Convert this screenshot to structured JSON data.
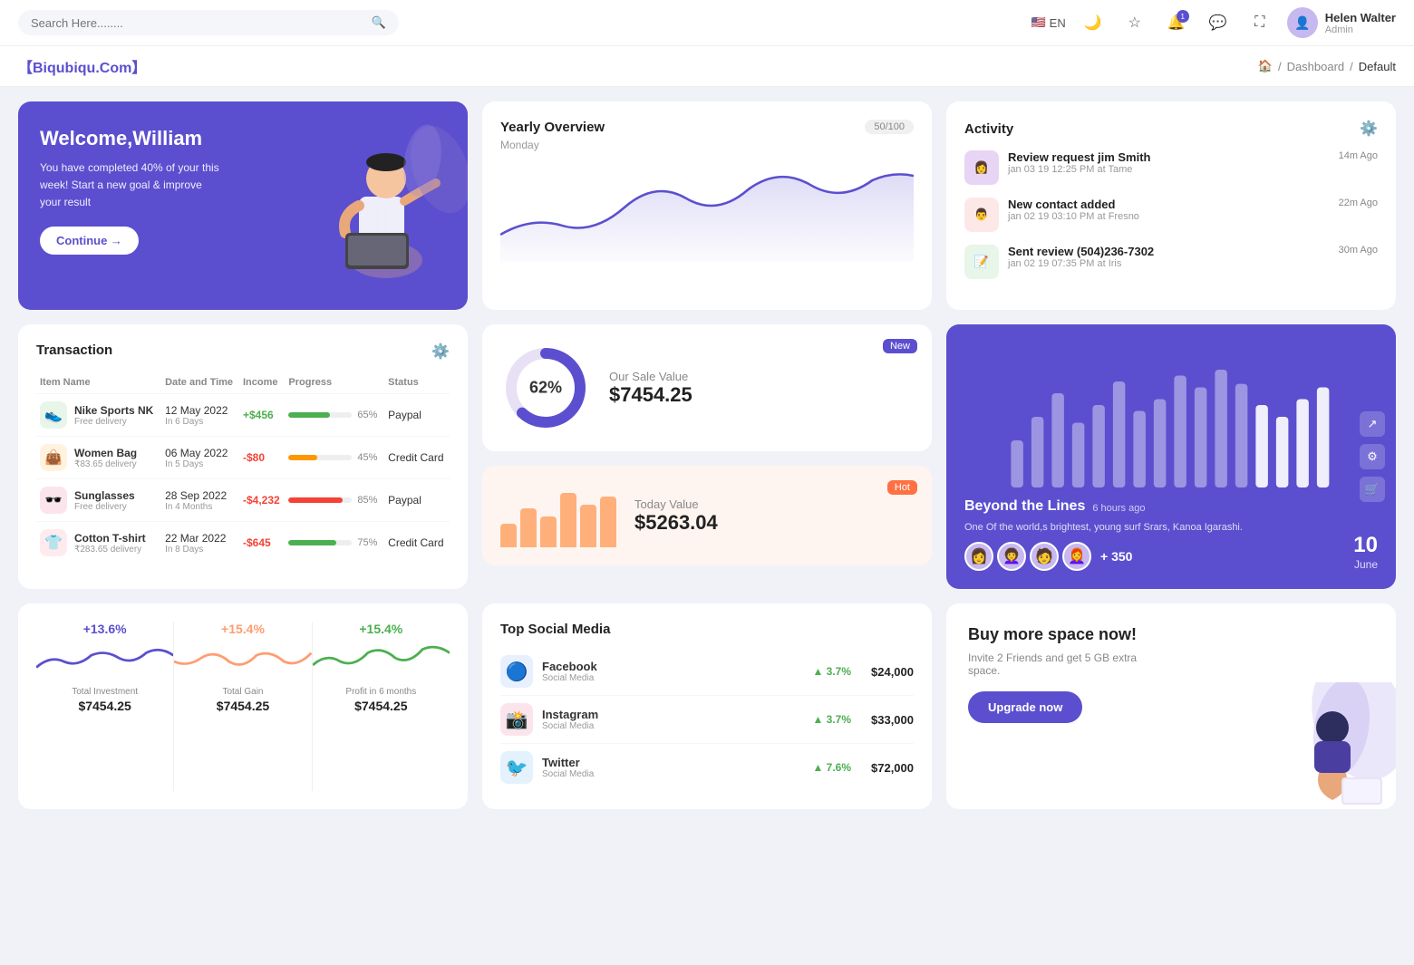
{
  "topnav": {
    "search_placeholder": "Search Here........",
    "lang": "EN",
    "user": {
      "name": "Helen Walter",
      "role": "Admin"
    },
    "notification_count": "1"
  },
  "breadcrumb": {
    "brand": "【Biqubiqu.Com】",
    "items": [
      "Home",
      "Dashboard",
      "Default"
    ]
  },
  "welcome": {
    "title": "Welcome,William",
    "description": "You have completed 40% of your this week! Start a new goal & improve your result",
    "button": "Continue →"
  },
  "yearly_overview": {
    "title": "Yearly Overview",
    "subtitle": "Monday",
    "badge": "50/100"
  },
  "activity": {
    "title": "Activity",
    "items": [
      {
        "title": "Review request jim Smith",
        "sub": "jan 03 19 12:25 PM at Tame",
        "time": "14m Ago"
      },
      {
        "title": "New contact added",
        "sub": "jan 02 19 03:10 PM at Fresno",
        "time": "22m Ago"
      },
      {
        "title": "Sent review (504)236-7302",
        "sub": "jan 02 19 07:35 PM at Iris",
        "time": "30m Ago"
      }
    ]
  },
  "transaction": {
    "title": "Transaction",
    "columns": [
      "Item Name",
      "Date and Time",
      "Income",
      "Progress",
      "Status"
    ],
    "rows": [
      {
        "name": "Nike Sports NK",
        "sub": "Free delivery",
        "date": "12 May 2022",
        "duration": "In 6 Days",
        "income": "+$456",
        "income_type": "pos",
        "progress": 65,
        "progress_color": "#4caf50",
        "status": "Paypal",
        "icon": "👟",
        "icon_bg": "#e8f5e9"
      },
      {
        "name": "Women Bag",
        "sub": "₹83.65 delivery",
        "date": "06 May 2022",
        "duration": "In 5 Days",
        "income": "-$80",
        "income_type": "neg",
        "progress": 45,
        "progress_color": "#ff9800",
        "status": "Credit Card",
        "icon": "👜",
        "icon_bg": "#fff3e0"
      },
      {
        "name": "Sunglasses",
        "sub": "Free delivery",
        "date": "28 Sep 2022",
        "duration": "In 4 Months",
        "income": "-$4,232",
        "income_type": "neg",
        "progress": 85,
        "progress_color": "#f44336",
        "status": "Paypal",
        "icon": "🕶️",
        "icon_bg": "#fce4ec"
      },
      {
        "name": "Cotton T-shirt",
        "sub": "₹283.65 delivery",
        "date": "22 Mar 2022",
        "duration": "In 8 Days",
        "income": "-$645",
        "income_type": "neg",
        "progress": 75,
        "progress_color": "#4caf50",
        "status": "Credit Card",
        "icon": "👕",
        "icon_bg": "#ffebee"
      }
    ]
  },
  "sale_value": {
    "label": "Our Sale Value",
    "value": "$7454.25",
    "percent": "62%",
    "badge": "New",
    "donut_filled": 62,
    "donut_total": 100
  },
  "today_value": {
    "label": "Today Value",
    "value": "$5263.04",
    "badge": "Hot",
    "bars": [
      30,
      50,
      40,
      70,
      55,
      65
    ]
  },
  "beyond": {
    "title": "Beyond the Lines",
    "time": "6 hours ago",
    "description": "One Of the world,s brightest, young surf Srars, Kanoa Igarashi.",
    "count": "+ 350",
    "date_day": "10",
    "date_month": "June",
    "bar_data": [
      40,
      60,
      80,
      55,
      70,
      90,
      65,
      75,
      95,
      85,
      100,
      88,
      70,
      60,
      75,
      85
    ]
  },
  "stats": [
    {
      "percent": "+13.6%",
      "label": "Total Investment",
      "value": "$7454.25",
      "color": "#5b4fcf"
    },
    {
      "percent": "+15.4%",
      "label": "Total Gain",
      "value": "$7454.25",
      "color": "#ff9d72"
    },
    {
      "percent": "+15.4%",
      "label": "Profit in 6 months",
      "value": "$7454.25",
      "color": "#4caf50"
    }
  ],
  "social": {
    "title": "Top Social Media",
    "items": [
      {
        "name": "Facebook",
        "sub": "Social Media",
        "growth": "3.7%",
        "amount": "$24,000",
        "color": "#1877f2",
        "icon": "f"
      },
      {
        "name": "Instagram",
        "sub": "Social Media",
        "growth": "3.7%",
        "amount": "$33,000",
        "color": "#e4405f",
        "icon": "📸"
      },
      {
        "name": "Twitter",
        "sub": "Social Media",
        "growth": "7.6%",
        "amount": "$72,000",
        "color": "#1da1f2",
        "icon": "🐦"
      }
    ]
  },
  "buy_space": {
    "title": "Buy more space now!",
    "description": "Invite 2 Friends and get 5 GB extra space.",
    "button": "Upgrade now"
  }
}
